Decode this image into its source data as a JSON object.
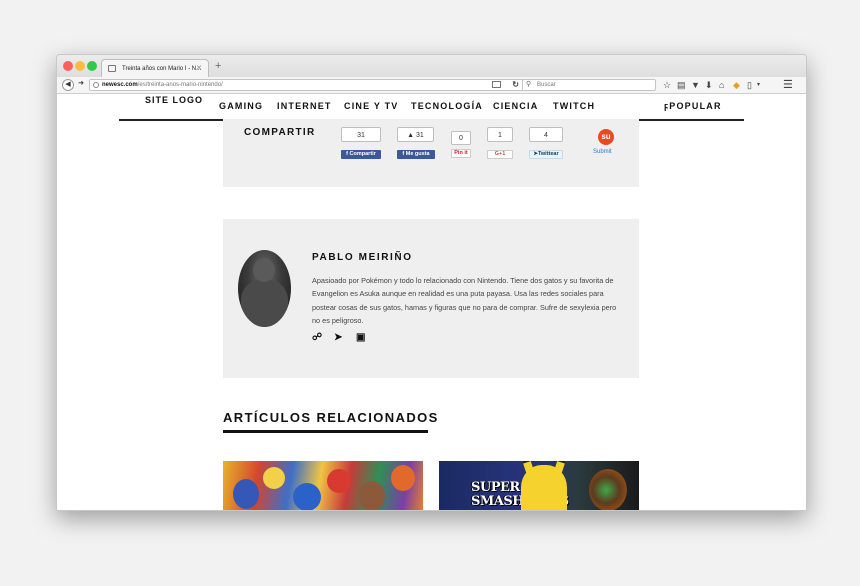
{
  "browser": {
    "tab_title": "Treinta años con Mario I - N...",
    "tab_close": "✕",
    "new_tab": "+",
    "url_host": "newesc.com",
    "url_path": "/es/treinta-anos-mario-nintendo/",
    "search_placeholder": "Buscar"
  },
  "site_nav": {
    "logo": "SITE LOGO",
    "items": [
      "GAMING",
      "INTERNET",
      "CINE Y TV",
      "TECNOLOGÍA",
      "CIENCIA",
      "TWITCH"
    ],
    "popular": "POPULAR",
    "popular_icon": "lightning-icon"
  },
  "share": {
    "label": "COMPARTIR",
    "facebook_count": "31",
    "facebook_label": "Compartir",
    "like_count": "31",
    "like_label": "Me gusta",
    "pinterest_count": "0",
    "pinterest_label": "Pin it",
    "gplus_count": "1",
    "gplus_label": "G+1",
    "twitter_count": "4",
    "twitter_label": "Twittear",
    "stumble_label": "Submit"
  },
  "author": {
    "name": "PABLO MEIRIÑO",
    "bio": "Apasioado por Pokémon y todo lo relacionado con Nintendo. Tiene dos gatos y su favorita de Evangelion es Asuka aunque en realidad es una puta payasa. Usa las redes sociales para postear cosas de sus gatos, hamas y figuras que no para de comprar. Sufre de sexylexia pero no es peligroso.",
    "social_icons": [
      "link-icon",
      "twitter-icon",
      "instagram-icon"
    ]
  },
  "related": {
    "title": "ARTÍCULOS RELACIONADOS",
    "thumb2_text_line1": "SUPER",
    "thumb2_text_line2": "SMASH BROS"
  },
  "colors": {
    "facebook": "#3b5998",
    "stumbleupon": "#eb4924",
    "panel_bg": "#efefef"
  }
}
